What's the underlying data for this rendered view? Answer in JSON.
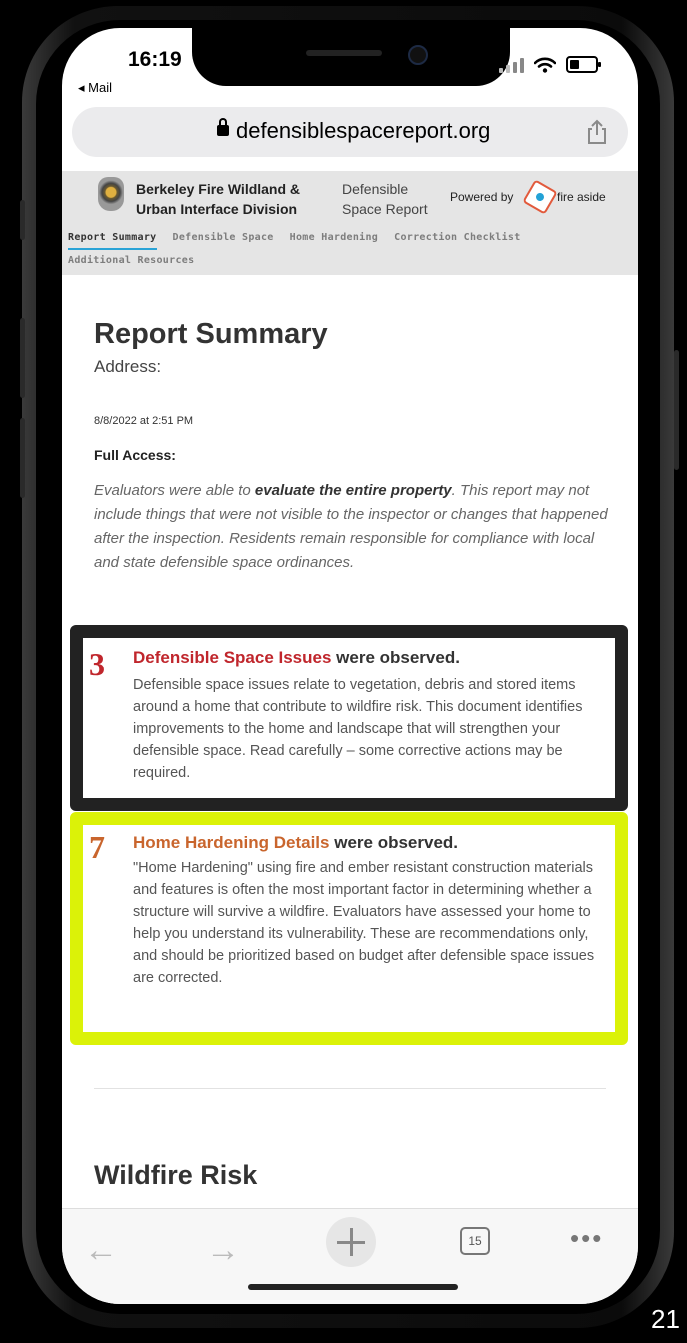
{
  "status_bar": {
    "time": "16:19",
    "back_app": "◂ Mail"
  },
  "browser": {
    "url": "defensiblespacereport.org",
    "tab_count": "15"
  },
  "header": {
    "org_name": "Berkeley Fire Wildland & Urban Interface Division",
    "report_name": "Defensible Space Report",
    "powered_by": "Powered by",
    "partner": "fire aside"
  },
  "nav": {
    "tabs": [
      {
        "label": "Report Summary",
        "active": true
      },
      {
        "label": "Defensible Space"
      },
      {
        "label": "Home Hardening"
      },
      {
        "label": "Correction Checklist"
      },
      {
        "label": "Additional Resources"
      }
    ]
  },
  "report": {
    "title": "Report Summary",
    "address_label": "Address:",
    "date": "8/8/2022 at 2:51 PM",
    "access_label": "Full Access:",
    "note_prefix": "Evaluators were able to ",
    "note_bold": "evaluate the entire property",
    "note_suffix": ". This report may not include things that were not visible to the inspector or changes that happened after the inspection. Residents remain responsible for compliance with local and state defensible space ordinances."
  },
  "cards": [
    {
      "count": "3",
      "title": "Defensible Space Issues",
      "title_suffix": " were observed.",
      "color": "#c0262c",
      "highlight": "#222222",
      "body": "Defensible space issues relate to vegetation, debris and stored items around a home that contribute to wildfire risk. This document identifies improvements to the home and landscape that will strengthen your defensible space. Read carefully – some corrective actions may be required."
    },
    {
      "count": "7",
      "title": "Home Hardening Details",
      "title_suffix": " were observed.",
      "color": "#c9652d",
      "highlight": "#dbf208",
      "body": "\"Home Hardening\" using fire and ember resistant construction materials and features is often the most important factor in determining whether a structure will survive a wildfire. Evaluators have assessed your home to help you understand its vulnerability. These are recommendations only, and should be prioritized based on budget after defensible space issues are corrected."
    }
  ],
  "next_section": {
    "title": "Wildfire Risk"
  },
  "toolbar": {
    "back": "←",
    "forward": "→",
    "more": "•••"
  },
  "slide_number": "21"
}
